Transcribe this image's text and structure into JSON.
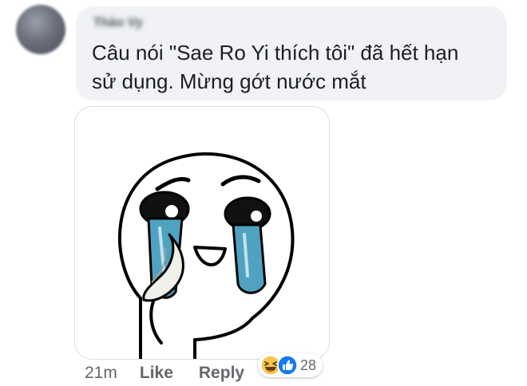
{
  "comment": {
    "author_name": "Thảo Vy",
    "text_line1": "Câu nói \"Sae Ro Yi thích tôi\" đã hết hạn",
    "text_line2": "sử dụng. Mừng gớt nước mắt",
    "attachment": {
      "type": "sticker",
      "icon": "crying-face-sticker-icon"
    },
    "actions": {
      "time": "21m",
      "like_label": "Like",
      "reply_label": "Reply"
    },
    "reactions": {
      "icons": [
        "laughing-reaction-icon",
        "like-reaction-icon"
      ],
      "count": "28"
    }
  },
  "colors": {
    "bubble_bg": "#f0f2f5",
    "text": "#1c1e21",
    "meta_text": "#65676b",
    "like_blue": "#1877f2",
    "haha_yellow": "#f7c64a",
    "tears_blue": "#4fa3c0"
  }
}
